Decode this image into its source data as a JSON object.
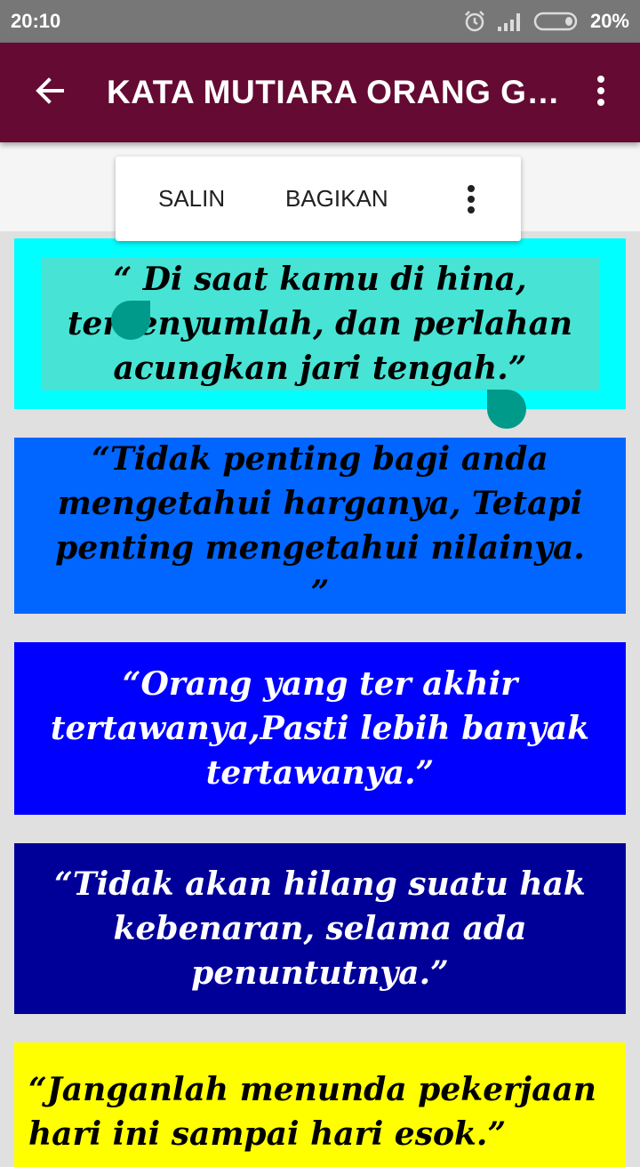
{
  "status_bar": {
    "time": "20:10",
    "battery": "20%",
    "icons": [
      "alarm-icon",
      "signal-icon",
      "battery-icon"
    ]
  },
  "app_bar": {
    "title": "KATA MUTIARA ORANG GILA",
    "background": "#640a33",
    "back_icon": "arrow-left-icon",
    "overflow_icon": "more-vert-icon"
  },
  "context_menu": {
    "copy_label": "SALIN",
    "share_label": "BAGIKAN",
    "more_icon": "more-vert-icon"
  },
  "quotes": [
    {
      "text": "“ Di saat kamu di hina, tersenyumlah, dan perlahan acungkan jari tengah.”",
      "background": "#00ffff",
      "color": "#000000",
      "selected": true
    },
    {
      "text": "“Tidak penting bagi anda mengetahui harganya, Tetapi penting mengetahui nilainya. ”",
      "background": "#0066ff",
      "color": "#000000"
    },
    {
      "text": "“Orang yang ter akhir tertawanya,Pasti lebih banyak tertawanya.”",
      "background": "#0000ff",
      "color": "#ffffff"
    },
    {
      "text": "“Tidak akan hilang suatu hak kebenaran, selama ada penuntutnya.”",
      "background": "#000099",
      "color": "#ffffff"
    },
    {
      "text": "“Janganlah menunda pekerjaan hari ini sampai hari esok.”",
      "background": "#ffff00",
      "color": "#000000"
    }
  ],
  "selection_color": "#47e3d5",
  "handle_color": "#009a8a"
}
